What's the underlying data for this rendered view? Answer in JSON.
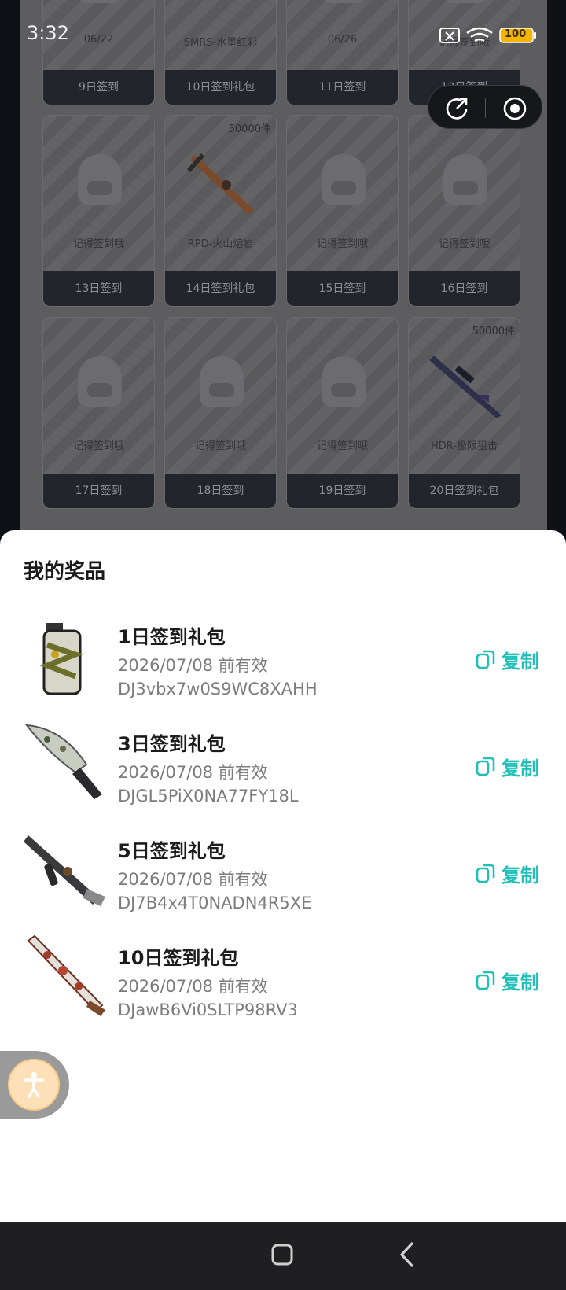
{
  "status_bar": {
    "time": "3:32",
    "battery": "100"
  },
  "calendar": {
    "rows": [
      [
        {
          "caption": "06/22",
          "label": "9日签到",
          "type": "placeholder"
        },
        {
          "caption": "SMRS-水墨红彩",
          "label": "10日签到礼包",
          "type": "item"
        },
        {
          "caption": "06/26",
          "label": "11日签到",
          "type": "placeholder"
        },
        {
          "caption": "记得签到哦",
          "label": "12日签到",
          "type": "placeholder"
        }
      ],
      [
        {
          "caption": "记得签到哦",
          "label": "13日签到",
          "type": "placeholder"
        },
        {
          "caption": "RPD-火山熔岩",
          "label": "14日签到礼包",
          "badge": "50000件",
          "type": "item"
        },
        {
          "caption": "记得签到哦",
          "label": "15日签到",
          "type": "placeholder"
        },
        {
          "caption": "记得签到哦",
          "label": "16日签到",
          "type": "placeholder"
        }
      ],
      [
        {
          "caption": "记得签到哦",
          "label": "17日签到",
          "type": "placeholder"
        },
        {
          "caption": "记得签到哦",
          "label": "18日签到",
          "type": "placeholder"
        },
        {
          "caption": "记得签到哦",
          "label": "19日签到",
          "type": "placeholder"
        },
        {
          "caption": "HDR-极限狙击",
          "label": "20日签到礼包",
          "badge": "50000件",
          "type": "item"
        }
      ]
    ]
  },
  "sheet": {
    "title": "我的奖品",
    "copy_label": "复制",
    "prizes": [
      {
        "name": "1日签到礼包",
        "expiry": "2026/07/08 前有效",
        "code": "DJ3vbx7w0S9WC8XAHH",
        "icon": "grenade-icon"
      },
      {
        "name": "3日签到礼包",
        "expiry": "2026/07/08 前有效",
        "code": "DJGL5PiX0NA77FY18L",
        "icon": "knife-icon"
      },
      {
        "name": "5日签到礼包",
        "expiry": "2026/07/08 前有效",
        "code": "DJ7B4x4T0NADN4R5XE",
        "icon": "smg-icon"
      },
      {
        "name": "10日签到礼包",
        "expiry": "2026/07/08 前有效",
        "code": "DJawB6Vi0SLTP98RV3",
        "icon": "launcher-icon"
      }
    ]
  },
  "colors": {
    "accent": "#1fc0b8",
    "sheet_bg": "#ffffff",
    "nav_bg": "#1f1f21"
  }
}
